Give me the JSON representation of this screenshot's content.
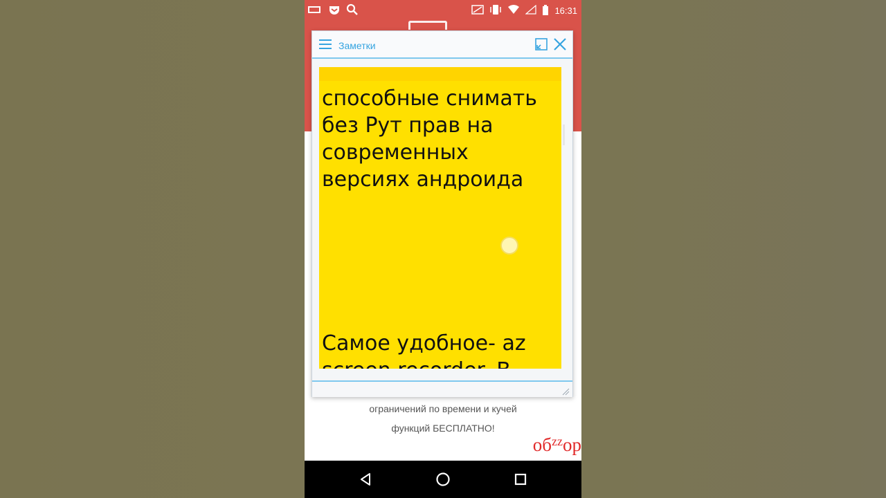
{
  "status_bar": {
    "time": "16:31",
    "left_icons": [
      "screen-icon",
      "pocket-icon",
      "search-icon"
    ],
    "right_icons": [
      "cast-icon",
      "vibrate-icon",
      "wifi-icon",
      "signal-icon",
      "battery-icon"
    ]
  },
  "popup": {
    "title": "Заметки",
    "note_text_top": "способные снимать без Рут прав на современных версиях андроида",
    "note_text_bottom": "Самое удобное- az screen recorder. В нем"
  },
  "page": {
    "line1": "ограничений по времени и кучей",
    "line2": "функций БЕСПЛАТНО!",
    "brand_a": "об",
    "brand_b": "zz",
    "brand_c": "op"
  },
  "nav": {
    "icons": [
      "back-icon",
      "home-icon",
      "recents-icon"
    ]
  },
  "colors": {
    "accent": "#36a4e0",
    "note": "#ffe000",
    "header_red": "#d9534a",
    "brand": "#e12a2a"
  }
}
